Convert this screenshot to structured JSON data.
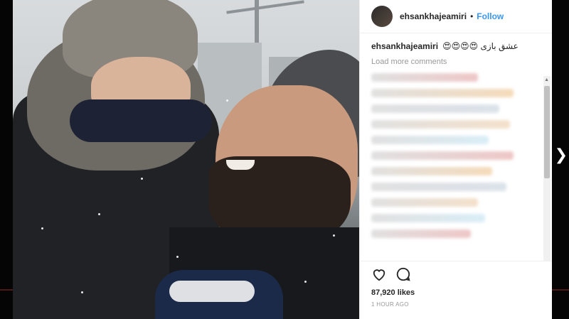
{
  "post": {
    "username": "ehsankhajeamiri",
    "dot": "•",
    "follow_label": "Follow",
    "caption_text": "😍😍😍😍 عشق بازی",
    "load_more": "Load more comments",
    "likes": "87,920 likes",
    "time": "1 HOUR AGO"
  },
  "icons": {
    "like": "heart-icon",
    "comment": "comment-icon",
    "next": "chevron-right-icon"
  },
  "blurred_comment_colors": [
    "#d7d7d7",
    "#e9b4b4",
    "#f2cfa3",
    "#cfd9e3",
    "#f0d6b9",
    "#cde8f4"
  ]
}
